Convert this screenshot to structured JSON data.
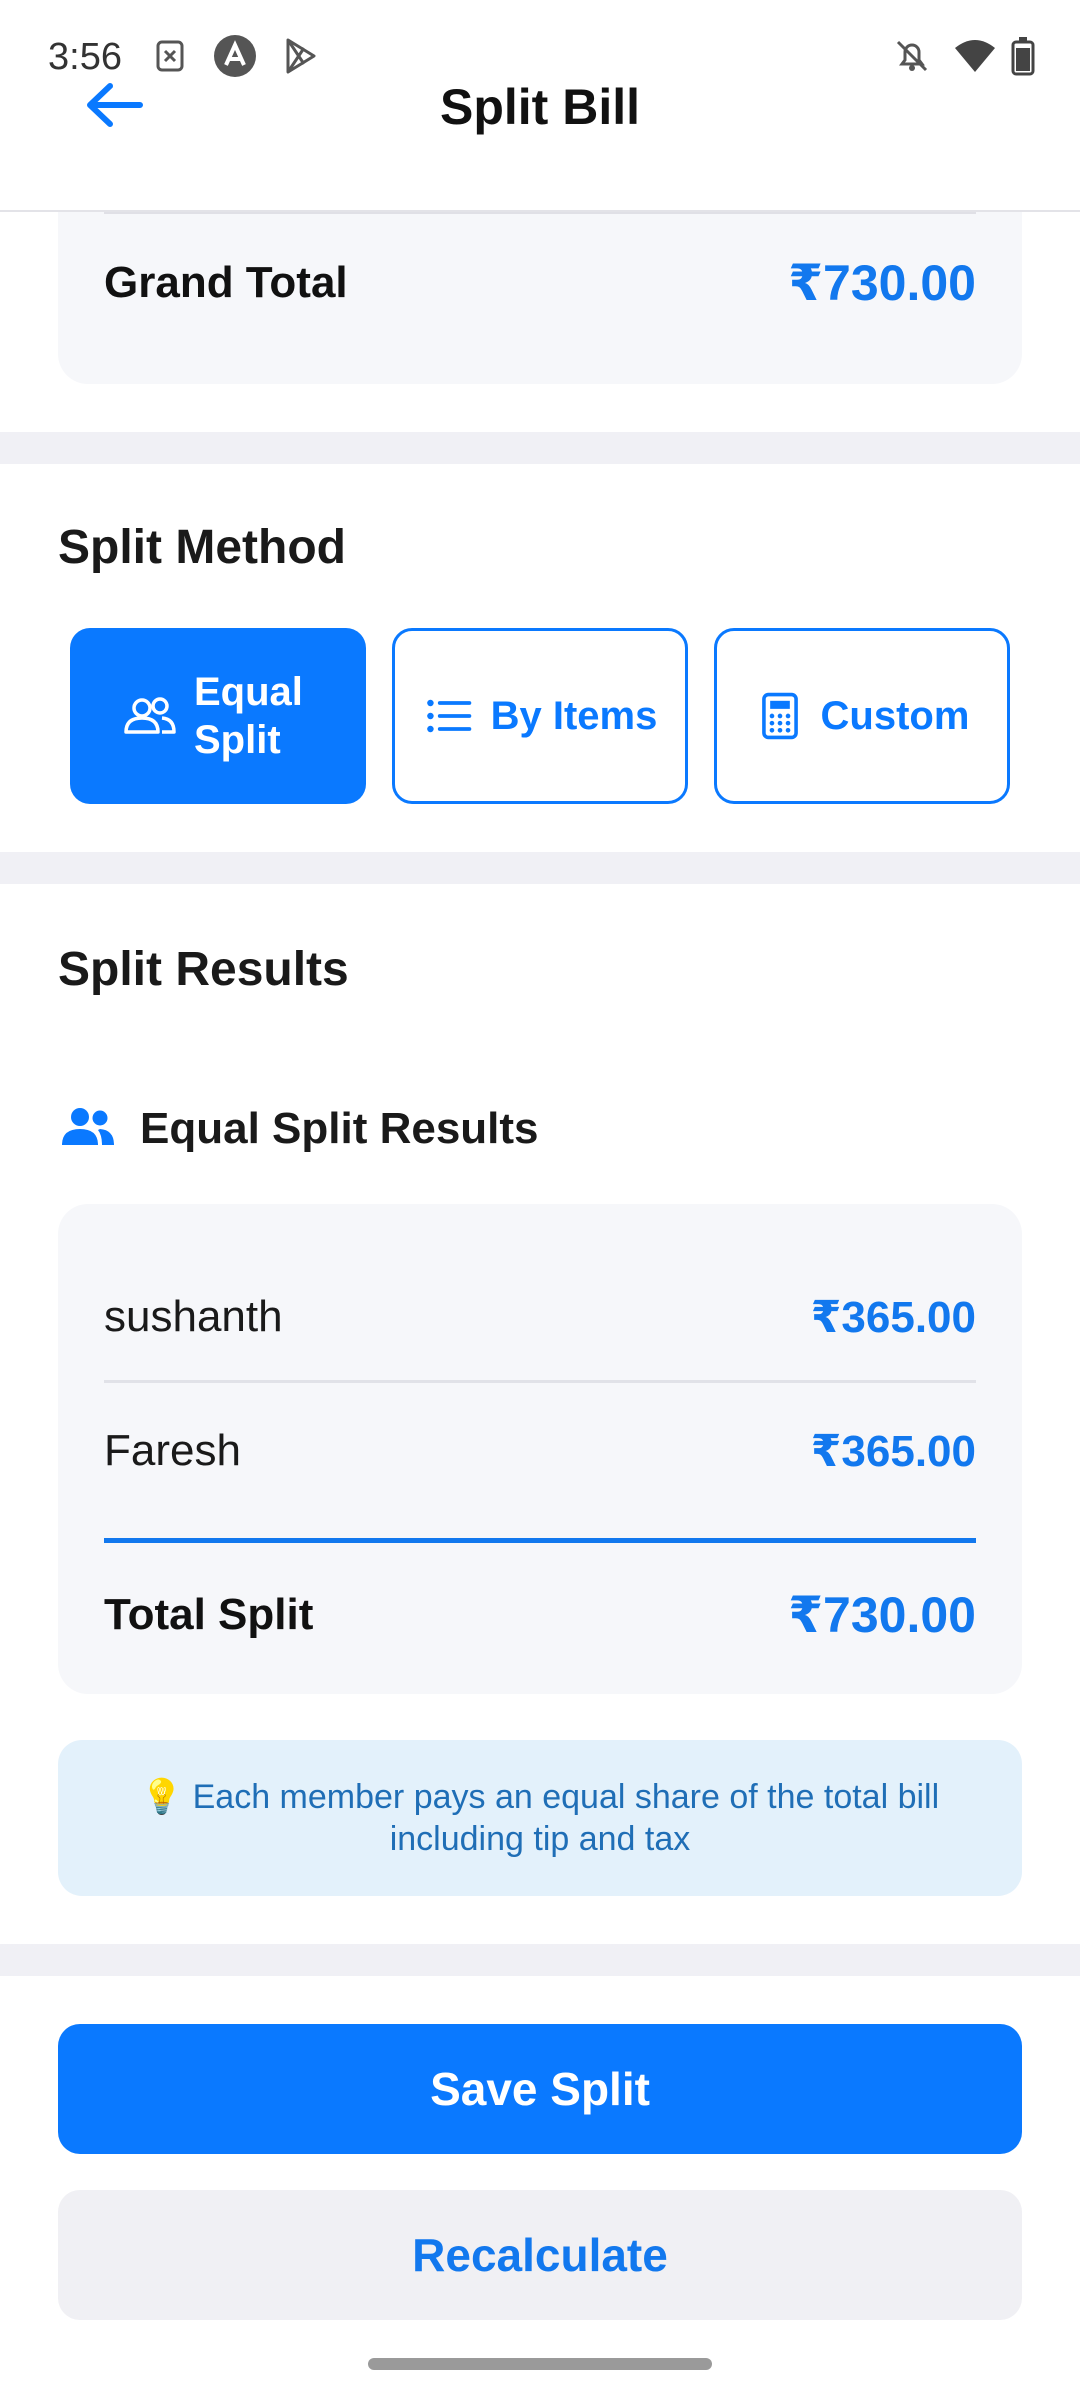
{
  "status_bar": {
    "time": "3:56"
  },
  "header": {
    "title": "Split Bill"
  },
  "summary": {
    "grand_total_label": "Grand Total",
    "grand_total_value": "₹730.00"
  },
  "split_method": {
    "title": "Split Method",
    "options": [
      {
        "label": "Equal Split",
        "icon": "people-icon",
        "selected": true
      },
      {
        "label": "By Items",
        "icon": "list-icon",
        "selected": false
      },
      {
        "label": "Custom",
        "icon": "calculator-icon",
        "selected": false
      }
    ]
  },
  "results": {
    "title": "Split Results",
    "subtitle": "Equal Split Results",
    "rows": [
      {
        "name": "sushanth",
        "amount": "₹365.00"
      },
      {
        "name": "Faresh",
        "amount": "₹365.00"
      }
    ],
    "total_label": "Total Split",
    "total_value": "₹730.00",
    "info": "💡 Each member pays an equal share of the total bill including tip and tax"
  },
  "actions": {
    "save_label": "Save Split",
    "recalculate_label": "Recalculate"
  },
  "colors": {
    "accent": "#0a79ff",
    "amount_blue": "#1278ee",
    "info_bg": "#e3f1fb"
  }
}
